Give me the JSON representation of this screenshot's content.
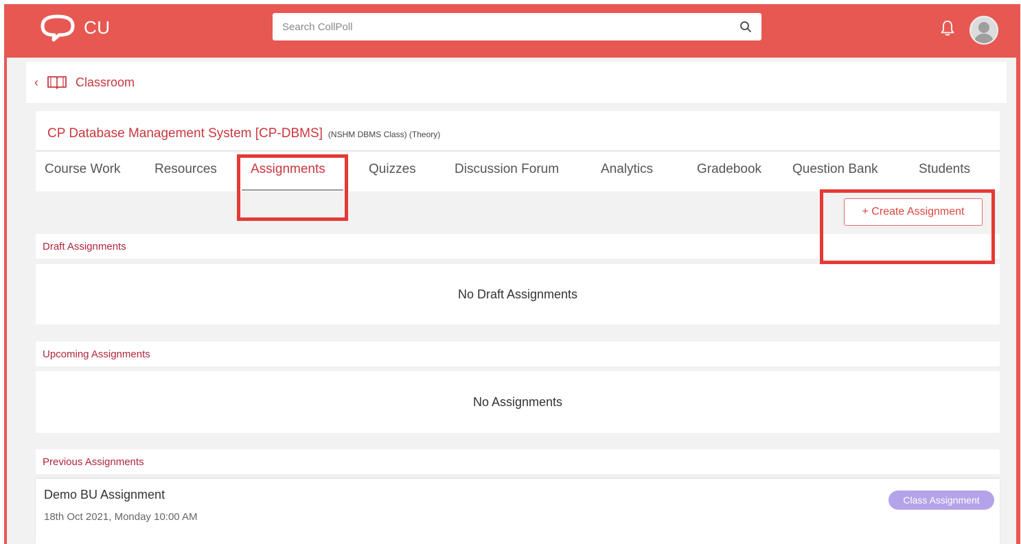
{
  "header": {
    "logo_text": "CU",
    "search": {
      "placeholder": "Search CollPoll"
    },
    "icons": [
      "search-icon",
      "bell-icon",
      "avatar"
    ],
    "brand_color": "#e85852"
  },
  "breadcrumb": {
    "label": "Classroom",
    "icon": "book-icon"
  },
  "course": {
    "name": "CP Database Management System [CP-DBMS]",
    "subtitle": "(NSHM DBMS Class)  (Theory)"
  },
  "tabs": [
    {
      "label": "Course Work"
    },
    {
      "label": "Resources"
    },
    {
      "label": "Assignments",
      "active": true
    },
    {
      "label": "Quizzes"
    },
    {
      "label": "Discussion Forum"
    },
    {
      "label": "Analytics"
    },
    {
      "label": "Gradebook"
    },
    {
      "label": "Question Bank"
    },
    {
      "label": "Students"
    }
  ],
  "create_button": "+ Create Assignment",
  "sections": {
    "draft": {
      "title": "Draft Assignments",
      "empty": "No Draft Assignments"
    },
    "upcoming": {
      "title": "Upcoming Assignments",
      "empty": "No Assignments"
    },
    "previous": {
      "title": "Previous Assignments",
      "items": [
        {
          "title": "Demo BU Assignment",
          "date": "18th Oct 2021, Monday 10:00 AM",
          "badge": "Class Assignment"
        }
      ]
    }
  },
  "highlight_color": "#e53935",
  "badge_color": "#b5a3e9"
}
